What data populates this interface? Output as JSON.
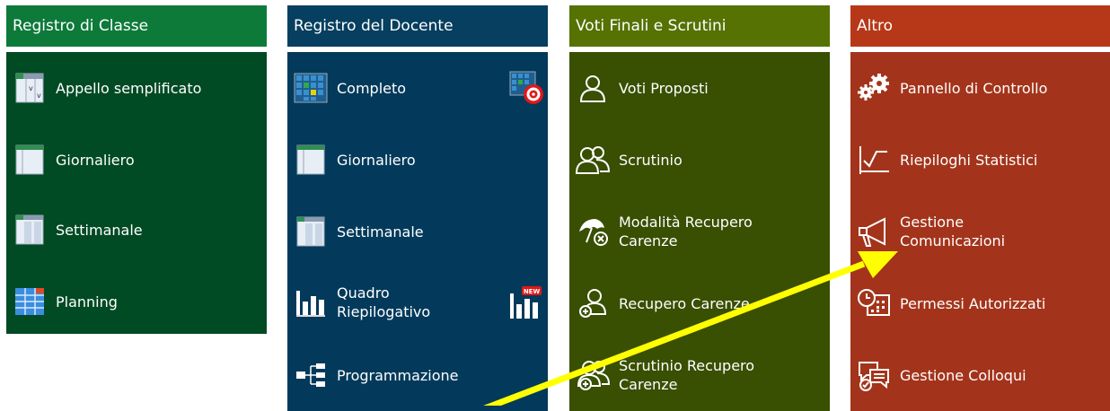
{
  "columns": [
    {
      "title": "Registro di Classe",
      "items": [
        {
          "label": "Appello semplificato",
          "icon": "register-sheet-icon"
        },
        {
          "label": "Giornaliero",
          "icon": "daily-sheet-icon"
        },
        {
          "label": "Settimanale",
          "icon": "weekly-sheet-icon"
        },
        {
          "label": "Planning",
          "icon": "planning-grid-icon"
        }
      ]
    },
    {
      "title": "Registro del Docente",
      "items": [
        {
          "label": "Completo",
          "icon": "calendar-grid-icon",
          "extra_icon": "calendar-target-icon"
        },
        {
          "label": "Giornaliero",
          "icon": "daily-sheet-icon"
        },
        {
          "label": "Settimanale",
          "icon": "weekly-sheet-icon"
        },
        {
          "label": "Quadro Riepilogativo",
          "icon": "bar-chart-icon",
          "extra_icon": "bar-chart-new-icon",
          "extra_badge": "NEW"
        },
        {
          "label": "Programmazione",
          "icon": "hierarchy-icon"
        }
      ]
    },
    {
      "title": "Voti Finali e Scrutini",
      "items": [
        {
          "label": "Voti Proposti",
          "icon": "user-outline-icon"
        },
        {
          "label": "Scrutinio",
          "icon": "users-outline-icon"
        },
        {
          "label": "Modalità Recupero Carenze",
          "icon": "umbrella-x-icon"
        },
        {
          "label": "Recupero Carenze",
          "icon": "user-plus-icon"
        },
        {
          "label": "Scrutinio Recupero Carenze",
          "icon": "users-plus-icon"
        }
      ]
    },
    {
      "title": "Altro",
      "items": [
        {
          "label": "Pannello di Controllo",
          "icon": "gears-icon"
        },
        {
          "label": "Riepiloghi Statistici",
          "icon": "line-chart-icon"
        },
        {
          "label": "Gestione Comunicazioni",
          "icon": "megaphone-icon"
        },
        {
          "label": "Permessi Autorizzati",
          "icon": "clock-calendar-icon"
        },
        {
          "label": "Gestione Colloqui",
          "icon": "chat-check-icon"
        }
      ]
    }
  ],
  "annotation": {
    "color": "#ffff00",
    "icon": "pointer-arrow-icon"
  }
}
